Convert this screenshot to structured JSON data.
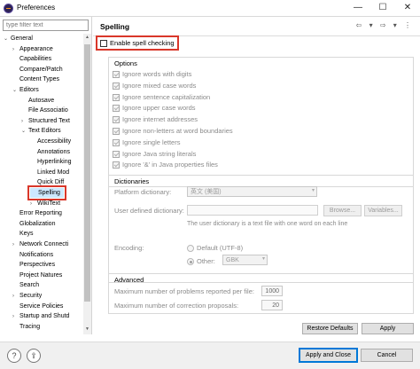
{
  "window": {
    "title": "Preferences",
    "min": "—",
    "max": "☐",
    "close": "✕"
  },
  "sidebar": {
    "filter_placeholder": "type filter text",
    "items": [
      {
        "label": "General",
        "indent": 0,
        "arrow": "⌄"
      },
      {
        "label": "Appearance",
        "indent": 1,
        "arrow": "›"
      },
      {
        "label": "Capabilities",
        "indent": 1,
        "arrow": ""
      },
      {
        "label": "Compare/Patch",
        "indent": 1,
        "arrow": ""
      },
      {
        "label": "Content Types",
        "indent": 1,
        "arrow": ""
      },
      {
        "label": "Editors",
        "indent": 1,
        "arrow": "⌄"
      },
      {
        "label": "Autosave",
        "indent": 2,
        "arrow": ""
      },
      {
        "label": "File Associatio",
        "indent": 2,
        "arrow": ""
      },
      {
        "label": "Structured Text",
        "indent": 2,
        "arrow": "›"
      },
      {
        "label": "Text Editors",
        "indent": 2,
        "arrow": "⌄"
      },
      {
        "label": "Accessibility",
        "indent": 3,
        "arrow": ""
      },
      {
        "label": "Annotations",
        "indent": 3,
        "arrow": ""
      },
      {
        "label": "Hyperlinking",
        "indent": 3,
        "arrow": ""
      },
      {
        "label": "Linked Mod",
        "indent": 3,
        "arrow": ""
      },
      {
        "label": "Quick Diff",
        "indent": 3,
        "arrow": ""
      },
      {
        "label": "Spelling",
        "indent": 3,
        "arrow": "",
        "selected": true
      },
      {
        "label": "WikiText",
        "indent": 3,
        "arrow": "›"
      },
      {
        "label": "Error Reporting",
        "indent": 1,
        "arrow": ""
      },
      {
        "label": "Globalization",
        "indent": 1,
        "arrow": ""
      },
      {
        "label": "Keys",
        "indent": 1,
        "arrow": ""
      },
      {
        "label": "Network Connecti",
        "indent": 1,
        "arrow": "›"
      },
      {
        "label": "Notifications",
        "indent": 1,
        "arrow": ""
      },
      {
        "label": "Perspectives",
        "indent": 1,
        "arrow": ""
      },
      {
        "label": "Project Natures",
        "indent": 1,
        "arrow": ""
      },
      {
        "label": "Search",
        "indent": 1,
        "arrow": ""
      },
      {
        "label": "Security",
        "indent": 1,
        "arrow": "›"
      },
      {
        "label": "Service Policies",
        "indent": 1,
        "arrow": ""
      },
      {
        "label": "Startup and Shutd",
        "indent": 1,
        "arrow": "›"
      },
      {
        "label": "Tracing",
        "indent": 1,
        "arrow": ""
      }
    ]
  },
  "page": {
    "title": "Spelling",
    "nav_icons": "⇦ ▾ ⇨ ▾ ⋮",
    "enable_label": "Enable spell checking",
    "options_group": "Options",
    "options": [
      "Ignore words with digits",
      "Ignore mixed case words",
      "Ignore sentence capitalization",
      "Ignore upper case words",
      "Ignore internet addresses",
      "Ignore non-letters at word boundaries",
      "Ignore single letters",
      "Ignore Java string literals",
      "Ignore '&' in Java properties files"
    ],
    "dictionaries_group": "Dictionaries",
    "platform_dict_label": "Platform dictionary:",
    "platform_dict_value": "英文 (美国)",
    "user_dict_label": "User defined dictionary:",
    "browse_label": "Browse...",
    "variables_label": "Variables...",
    "user_dict_hint": "The user dictionary is a text file with one word on each line",
    "encoding_label": "Encoding:",
    "default_encoding": "Default (UTF-8)",
    "other_label": "Other:",
    "other_value": "GBK",
    "advanced_group": "Advanced",
    "max_problems_label": "Maximum number of problems reported per file:",
    "max_problems_value": "1000",
    "max_proposals_label": "Maximum number of correction proposals:",
    "max_proposals_value": "20",
    "restore_defaults": "Restore Defaults",
    "apply": "Apply"
  },
  "footer": {
    "help_icon": "?",
    "import_icon": "⇪",
    "apply_close": "Apply and Close",
    "cancel": "Cancel"
  }
}
